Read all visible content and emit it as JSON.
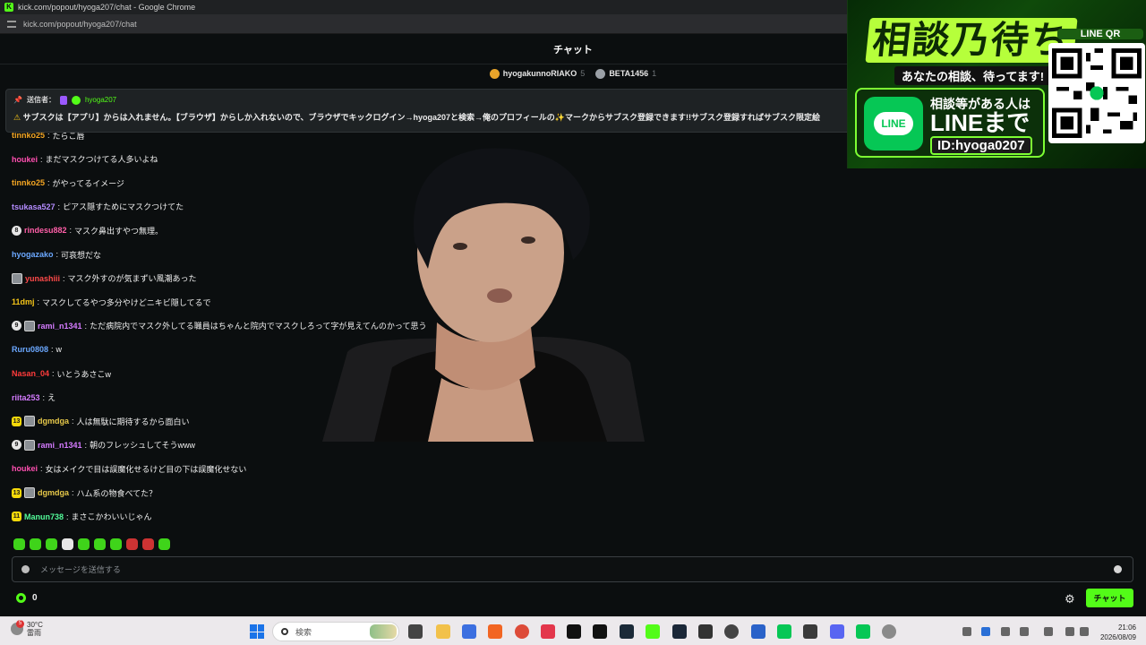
{
  "browser": {
    "title": "kick.com/popout/hyoga207/chat - Google Chrome",
    "url": "kick.com/popout/hyoga207/chat"
  },
  "chat": {
    "title": "チャット",
    "leaderboard": [
      {
        "name": "hyogakunnoRIAKO",
        "count": "5"
      },
      {
        "name": "BETA1456",
        "count": "1"
      }
    ],
    "pinned": {
      "label": "送信者：",
      "sender": "hyoga207",
      "text": "サブスクは【アプリ】からは入れません。【ブラウザ】からしか入れないので、ブラウザでキックログイン→hyoga207と検索→俺のプロフィールの✨マークからサブスク登録できます!!サブスク登録すればサブスク限定絵"
    },
    "messages": [
      {
        "user": "tinnko25",
        "text": "たらこ唇",
        "color": "#f5a623",
        "badges": []
      },
      {
        "user": "houkei",
        "text": "まだマスクつけてる人多いよね",
        "color": "#ff4fb0",
        "badges": []
      },
      {
        "user": "tinnko25",
        "text": "がやってるイメージ",
        "color": "#f5a623",
        "badges": []
      },
      {
        "user": "tsukasa527",
        "text": "ピアス隠すためにマスクつけてた",
        "color": "#b48cff",
        "badges": []
      },
      {
        "user": "rindesu882",
        "text": "マスク鼻出すやつ無理。",
        "color": "#ff5fa8",
        "badges": [
          "8"
        ]
      },
      {
        "user": "hyogazako",
        "text": "可哀想だな",
        "color": "#6ba8ff",
        "badges": []
      },
      {
        "user": "yunashiii",
        "text": "マスク外すのが気まずい風潮あった",
        "color": "#ff4a4a",
        "badges": [
          "og"
        ]
      },
      {
        "user": "11dmj",
        "text": "マスクしてるやつ多分やけどニキビ隠してるで",
        "color": "#f5c518",
        "badges": []
      },
      {
        "user": "rami_n1341",
        "text": "ただ病院内でマスク外してる職員はちゃんと院内でマスクしろって字が見えてんのかって思う",
        "color": "#d57bff",
        "badges": [
          "9",
          "og"
        ]
      },
      {
        "user": "Ruru0808",
        "text": "w",
        "color": "#6ba8ff",
        "badges": []
      },
      {
        "user": "Nasan_04",
        "text": "いとうあさこw",
        "color": "#ff3b3b",
        "badges": []
      },
      {
        "user": "riita253",
        "text": "え",
        "color": "#d57bff",
        "badges": []
      },
      {
        "user": "dgmdga",
        "text": "人は無駄に期待するから面白い",
        "color": "#e6c84a",
        "badges": [
          "13",
          "og"
        ]
      },
      {
        "user": "rami_n1341",
        "text": "朝のフレッシュしてそうwww",
        "color": "#d57bff",
        "badges": [
          "9",
          "og"
        ]
      },
      {
        "user": "houkei",
        "text": "女はメイクで目は誤魔化せるけど目の下は誤魔化せない",
        "color": "#ff4fb0",
        "badges": []
      },
      {
        "user": "dgmdga",
        "text": "ハム系の物食べてた？",
        "color": "#e6c84a",
        "badges": [
          "13",
          "og"
        ]
      },
      {
        "user": "Manun738",
        "text": "まさこかわいいじゃん",
        "color": "#53fc9a",
        "badges": [
          "11"
        ]
      }
    ],
    "input_placeholder": "メッセージを送信する",
    "points": "0",
    "send_label": "チャット"
  },
  "ad": {
    "headline": "相談乃待ち",
    "sub": "あなたの相談、待ってます!",
    "line_logo": "LINE",
    "line1": "相談等がある人は",
    "line2": "LINEまで",
    "line3": "ID:hyoga0207",
    "qr_label": "LINE QR"
  },
  "taskbar": {
    "weather_temp": "30°C",
    "weather_desc": "雷雨",
    "weather_badge": "5",
    "search_label": "検索",
    "time": "21:06",
    "date": "2026/08/09"
  }
}
